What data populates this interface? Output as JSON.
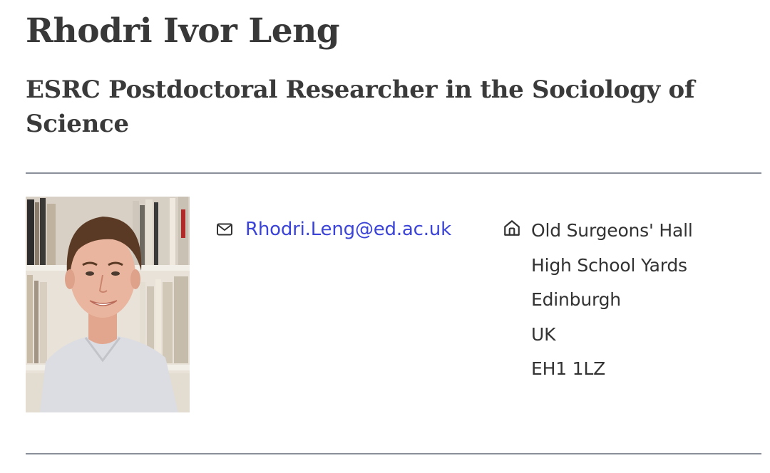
{
  "profile": {
    "name": "Rhodri Ivor Leng",
    "role": "ESRC Postdoctoral Researcher in the Sociology of Science"
  },
  "contact": {
    "email_icon": "envelope-icon",
    "email": "Rhodri.Leng@ed.ac.uk",
    "email_color": "#3b44d6",
    "address_icon": "home-icon",
    "address_lines": [
      "Old Surgeons' Hall",
      "High School Yards",
      "Edinburgh",
      "UK",
      "EH1 1LZ"
    ]
  },
  "colors": {
    "text": "#333333",
    "rule": "#8a9099"
  }
}
